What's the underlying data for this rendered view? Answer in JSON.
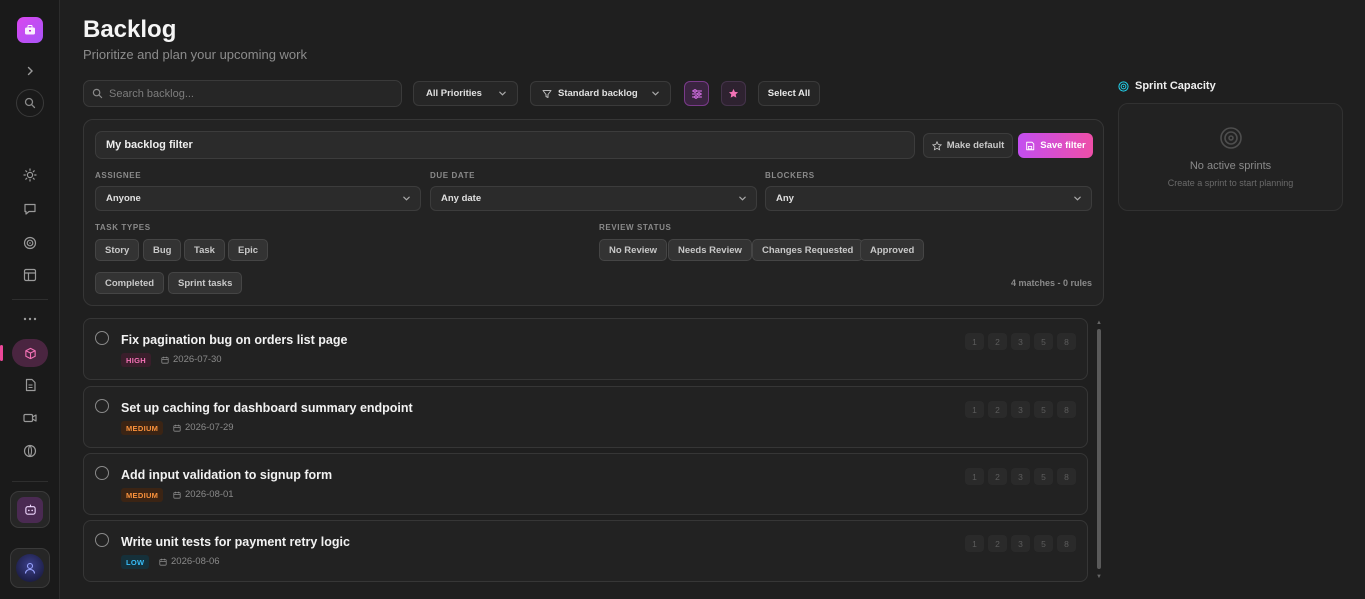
{
  "header": {
    "title": "Backlog",
    "subtitle": "Prioritize and plan your upcoming work"
  },
  "sidebar": {
    "items": [
      {
        "icon": "chevron-right-icon"
      },
      {
        "icon": "search-icon"
      },
      {
        "icon": "sun-icon"
      },
      {
        "icon": "chat-icon"
      },
      {
        "icon": "target-icon"
      },
      {
        "icon": "layout-icon"
      },
      {
        "icon": "more-icon"
      },
      {
        "icon": "cube-icon",
        "active": true
      },
      {
        "icon": "document-icon"
      },
      {
        "icon": "video-icon"
      },
      {
        "icon": "globe-icon"
      },
      {
        "icon": "bot-icon"
      },
      {
        "icon": "avatar"
      }
    ],
    "accent": "#ec4899"
  },
  "toolbar": {
    "search_placeholder": "Search backlog...",
    "priority_filter": "All Priorities",
    "view_filter": "Standard backlog",
    "select_all": "Select All"
  },
  "filter": {
    "name": "My backlog filter",
    "make_default": "Make default",
    "save_filter": "Save filter",
    "assignee_label": "ASSIGNEE",
    "assignee_value": "Anyone",
    "due_date_label": "DUE DATE",
    "due_date_value": "Any date",
    "blockers_label": "BLOCKERS",
    "blockers_value": "Any",
    "task_types_label": "TASK TYPES",
    "task_types": [
      "Story",
      "Bug",
      "Task",
      "Epic"
    ],
    "review_status_label": "REVIEW STATUS",
    "review_statuses": [
      "No Review",
      "Needs Review",
      "Changes Requested",
      "Approved"
    ],
    "extra_chips": [
      "Completed",
      "Sprint tasks"
    ],
    "matches": "4 matches - 0 rules"
  },
  "tasks": [
    {
      "title": "Fix pagination bug on orders list page",
      "priority": "HIGH",
      "due": "2026-07-30"
    },
    {
      "title": "Set up caching for dashboard summary endpoint",
      "priority": "MEDIUM",
      "due": "2026-07-29"
    },
    {
      "title": "Add input validation to signup form",
      "priority": "MEDIUM",
      "due": "2026-08-01"
    },
    {
      "title": "Write unit tests for payment retry logic",
      "priority": "LOW",
      "due": "2026-08-06"
    }
  ],
  "story_points": [
    "1",
    "2",
    "3",
    "5",
    "8"
  ],
  "capacity": {
    "title": "Sprint Capacity",
    "empty_title": "No active sprints",
    "empty_hint": "Create a sprint to start planning"
  },
  "colors": {
    "background": "#1f1f1f",
    "brand_gradient_start": "#c34ef0",
    "brand_gradient_end": "#ee4fa8",
    "high": "#f472b6",
    "medium": "#fb923c",
    "low": "#38bdf8",
    "capacity_accent": "#22d3ee"
  }
}
